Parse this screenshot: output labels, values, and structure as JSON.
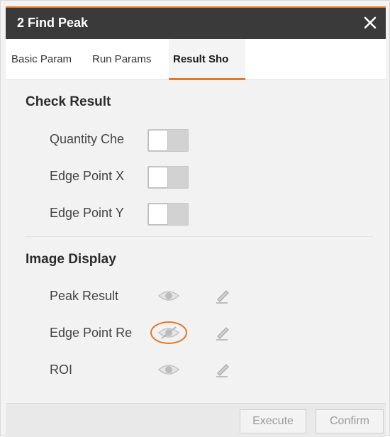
{
  "dialog": {
    "title": "2 Find Peak",
    "close_icon": "close-icon",
    "accent_color": "#e07a2a",
    "titlebar_color": "#3a3a3a"
  },
  "tabs": [
    {
      "label": "Basic Param",
      "active": false
    },
    {
      "label": "Run Params",
      "active": false
    },
    {
      "label": "Result Sho",
      "active": true
    }
  ],
  "check_result": {
    "title": "Check Result",
    "items": [
      {
        "label": "Quantity Che",
        "enabled": false
      },
      {
        "label": "Edge Point X",
        "enabled": false
      },
      {
        "label": "Edge Point Y",
        "enabled": false
      }
    ]
  },
  "image_display": {
    "title": "Image Display",
    "items": [
      {
        "label": "Peak Result",
        "visibility_icon": "eye-icon",
        "edit_icon": "pencil-icon",
        "highlighted": false
      },
      {
        "label": "Edge Point Re",
        "visibility_icon": "eye-hidden-icon",
        "edit_icon": "pencil-icon",
        "highlighted": true
      },
      {
        "label": "ROI",
        "visibility_icon": "eye-icon",
        "edit_icon": "pencil-icon",
        "highlighted": false
      }
    ]
  },
  "footer": {
    "execute_label": "Execute",
    "confirm_label": "Confirm"
  }
}
